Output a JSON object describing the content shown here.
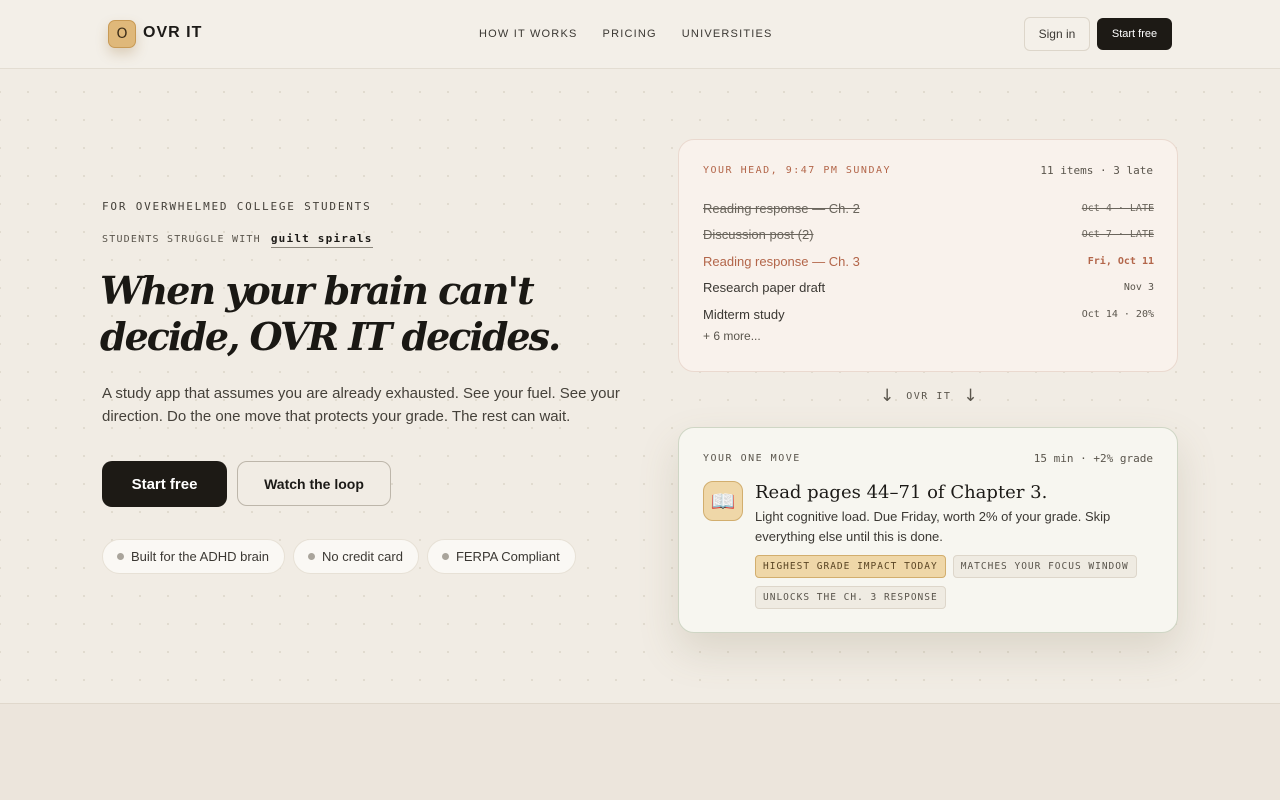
{
  "header": {
    "logo_mark": "O",
    "brand": "OVR IT",
    "nav": [
      "HOW IT WORKS",
      "PRICING",
      "UNIVERSITIES"
    ],
    "sign_in": "Sign in",
    "start_free": "Start free"
  },
  "hero": {
    "eyebrow": "FOR OVERWHELMED COLLEGE STUDENTS",
    "struggle_label": "STUDENTS STRUGGLE WITH",
    "struggle_value": "guilt spirals",
    "headline": "When your brain can't decide, OVR IT decides.",
    "subhead": "A study app that assumes you are already exhausted. See your fuel. See your direction. Do the one move that protects your grade. The rest can wait.",
    "cta_primary": "Start free",
    "cta_secondary": "Watch the loop",
    "pills": [
      "Built for the ADHD brain",
      "No credit card",
      "FERPA Compliant"
    ]
  },
  "head_card": {
    "title": "YOUR HEAD, 9:47 PM SUNDAY",
    "count": "11 items · 3 late",
    "items": [
      {
        "title": "Reading response — Ch. 2",
        "due": "Oct 4 · LATE"
      },
      {
        "title": "Discussion post (2)",
        "due": "Oct 7 · LATE"
      },
      {
        "title": "Reading response — Ch. 3",
        "due": "Fri, Oct 11"
      },
      {
        "title": "Research paper draft",
        "due": "Nov 3"
      },
      {
        "title": "Midterm study",
        "due": "Oct 14 · 20%"
      }
    ],
    "more": "+ 6 more..."
  },
  "divider": {
    "arrow": "↓",
    "label": "OVR IT"
  },
  "move_card": {
    "title": "YOUR ONE MOVE",
    "meta": "15 min · +2% grade",
    "icon": "📖",
    "heading": "Read pages 44–71 of Chapter 3.",
    "description": "Light cognitive load. Due Friday, worth 2% of your grade. Skip everything else until this is done.",
    "tags": [
      "HIGHEST GRADE IMPACT TODAY",
      "MATCHES YOUR FOCUS WINDOW",
      "UNLOCKS THE CH. 3 RESPONSE"
    ]
  }
}
